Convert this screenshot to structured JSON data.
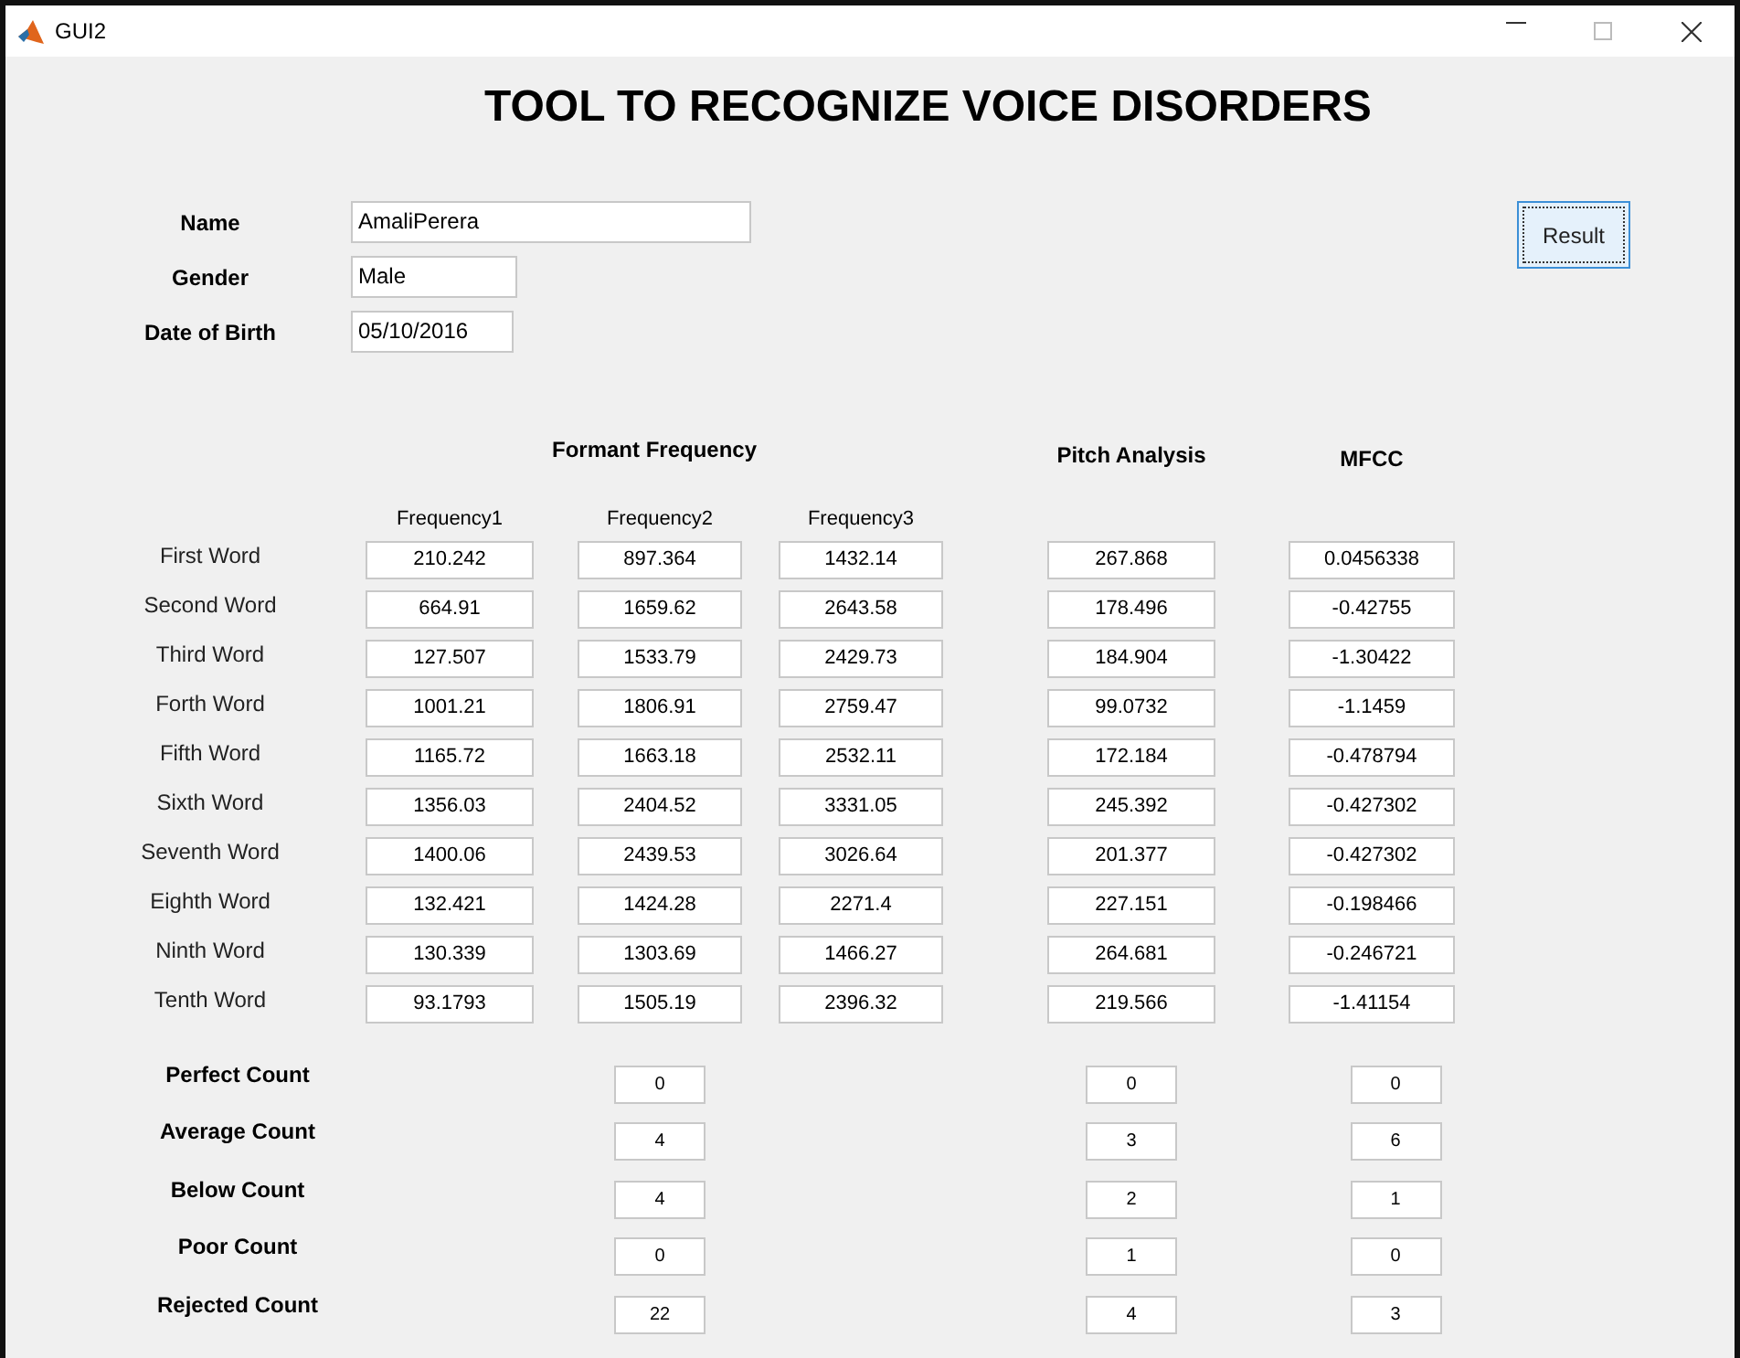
{
  "window": {
    "title": "GUI2"
  },
  "heading": "TOOL TO RECOGNIZE VOICE DISORDERS",
  "person_fields": [
    {
      "label": "Name",
      "value": "AmaliPerera"
    },
    {
      "label": "Gender",
      "value": "Male"
    },
    {
      "label": "Date of Birth",
      "value": "05/10/2016"
    }
  ],
  "result_button": "Result",
  "group_headings": [
    "Formant Frequency",
    "Pitch Analysis",
    "MFCC"
  ],
  "frequency_columns": [
    "Frequency1",
    "Frequency2",
    "Frequency3"
  ],
  "words": [
    {
      "label": "First Word",
      "formant": [
        "210.242",
        "897.364",
        "1432.14"
      ],
      "pitch": "267.868",
      "mfcc": "0.0456338"
    },
    {
      "label": "Second Word",
      "formant": [
        "664.91",
        "1659.62",
        "2643.58"
      ],
      "pitch": "178.496",
      "mfcc": "-0.42755"
    },
    {
      "label": "Third Word",
      "formant": [
        "127.507",
        "1533.79",
        "2429.73"
      ],
      "pitch": "184.904",
      "mfcc": "-1.30422"
    },
    {
      "label": "Forth Word",
      "formant": [
        "1001.21",
        "1806.91",
        "2759.47"
      ],
      "pitch": "99.0732",
      "mfcc": "-1.1459"
    },
    {
      "label": "Fifth Word",
      "formant": [
        "1165.72",
        "1663.18",
        "2532.11"
      ],
      "pitch": "172.184",
      "mfcc": "-0.478794"
    },
    {
      "label": "Sixth Word",
      "formant": [
        "1356.03",
        "2404.52",
        "3331.05"
      ],
      "pitch": "245.392",
      "mfcc": "-0.427302"
    },
    {
      "label": "Seventh Word",
      "formant": [
        "1400.06",
        "2439.53",
        "3026.64"
      ],
      "pitch": "201.377",
      "mfcc": "-0.427302"
    },
    {
      "label": "Eighth Word",
      "formant": [
        "132.421",
        "1424.28",
        "2271.4"
      ],
      "pitch": "227.151",
      "mfcc": "-0.198466"
    },
    {
      "label": "Ninth Word",
      "formant": [
        "130.339",
        "1303.69",
        "1466.27"
      ],
      "pitch": "264.681",
      "mfcc": "-0.246721"
    },
    {
      "label": "Tenth Word",
      "formant": [
        "93.1793",
        "1505.19",
        "2396.32"
      ],
      "pitch": "219.566",
      "mfcc": "-1.41154"
    }
  ],
  "counts": [
    {
      "label": "Perfect Count",
      "formant": "0",
      "pitch": "0",
      "mfcc": "0"
    },
    {
      "label": "Average Count",
      "formant": "4",
      "pitch": "3",
      "mfcc": "6"
    },
    {
      "label": "Below Count",
      "formant": "4",
      "pitch": "2",
      "mfcc": "1"
    },
    {
      "label": "Poor Count",
      "formant": "0",
      "pitch": "1",
      "mfcc": "0"
    },
    {
      "label": "Rejected Count",
      "formant": "22",
      "pitch": "4",
      "mfcc": "3"
    }
  ]
}
